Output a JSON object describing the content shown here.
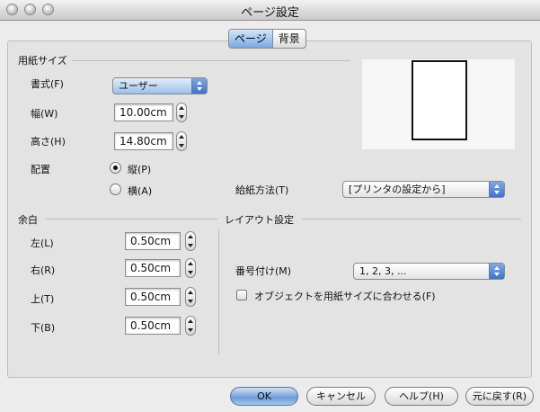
{
  "window": {
    "title": "ページ設定"
  },
  "tabs": [
    {
      "label": "ページ",
      "selected": true
    },
    {
      "label": "背景",
      "selected": false
    }
  ],
  "paper": {
    "section_title": "用紙サイズ",
    "format_label": "書式(F)",
    "format_value": "ユーザー",
    "width_label": "幅(W)",
    "width_value": "10.00cm",
    "height_label": "高さ(H)",
    "height_value": "14.80cm",
    "orientation_label": "配置",
    "portrait_label": "縦(P)",
    "landscape_label": "横(A)",
    "orientation_selected": "portrait",
    "tray_label": "給紙方法(T)",
    "tray_value": "[プリンタの設定から]"
  },
  "margins": {
    "section_title": "余白",
    "left_label": "左(L)",
    "left_value": "0.50cm",
    "right_label": "右(R)",
    "right_value": "0.50cm",
    "top_label": "上(T)",
    "top_value": "0.50cm",
    "bottom_label": "下(B)",
    "bottom_value": "0.50cm"
  },
  "layout": {
    "section_title": "レイアウト設定",
    "numbering_label": "番号付け(M)",
    "numbering_value": "1, 2, 3, ...",
    "fit_label": "オブジェクトを用紙サイズに合わせる(F)",
    "fit_checked": false
  },
  "buttons": {
    "ok": "OK",
    "cancel": "キャンセル",
    "help": "ヘルプ(H)",
    "reset": "元に戻す(R)"
  },
  "icons": [
    "close-light",
    "minimize-light",
    "zoom-light",
    "stepper-arrows-icon",
    "popup-arrows-icon"
  ]
}
